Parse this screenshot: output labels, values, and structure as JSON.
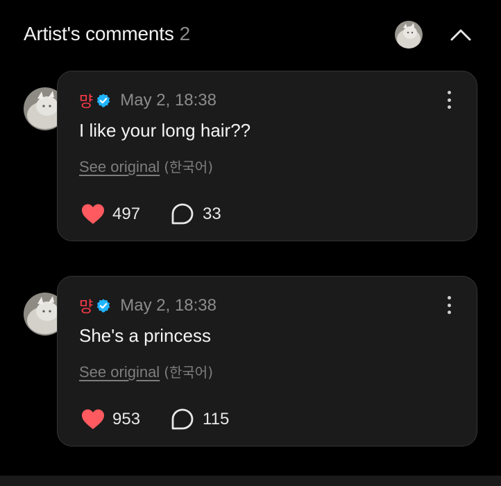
{
  "header": {
    "title": "Artist's comments",
    "count": "2"
  },
  "comments": [
    {
      "author": "먕",
      "date": "May 2, 18:38",
      "text": "I like your long hair??",
      "see_original": "See original",
      "original_language": "(한국어)",
      "likes": "497",
      "replies": "33"
    },
    {
      "author": "먕",
      "date": "May 2, 18:38",
      "text": "She's a princess",
      "see_original": "See original",
      "original_language": "(한국어)",
      "likes": "953",
      "replies": "115"
    }
  ],
  "colors": {
    "author": "#ff3b48",
    "heart": "#ff5a5f",
    "verified": "#1fb4ff",
    "card_bg": "#1b1b1b"
  },
  "icons": [
    "verified-badge-icon",
    "heart-icon",
    "comment-bubble-icon",
    "more-vertical-icon",
    "chevron-up-icon"
  ]
}
